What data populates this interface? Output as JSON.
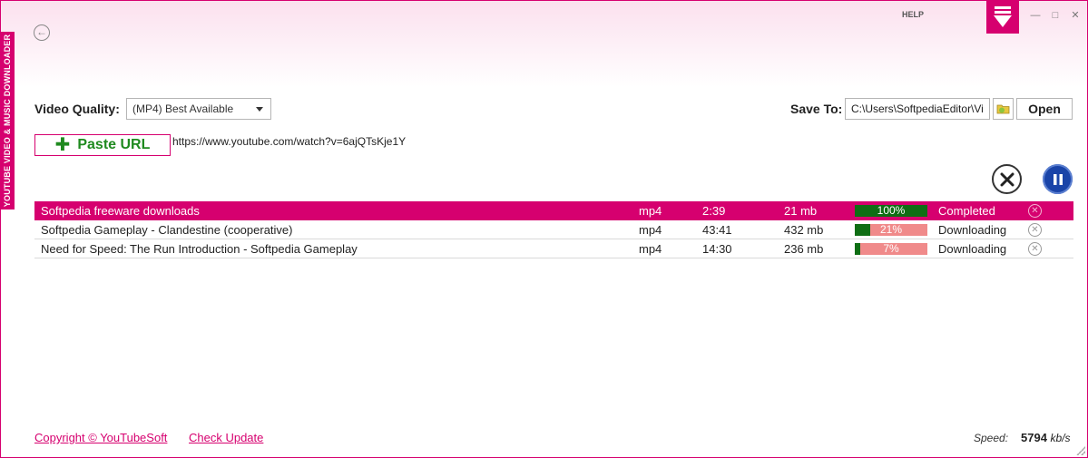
{
  "app": {
    "side_title": "YOUTUBE VIDEO & MUSIC DOWNLOADER",
    "help_label": "HELP",
    "brand_color": "#d6006f"
  },
  "settings": {
    "video_quality_label": "Video Quality:",
    "video_quality_value": "(MP4) Best Available",
    "save_to_label": "Save To:",
    "save_to_path": "C:\\Users\\SoftpediaEditor\\Vi",
    "open_label": "Open"
  },
  "url_bar": {
    "paste_label": "Paste URL",
    "url": "https://www.youtube.com/watch?v=6ajQTsKje1Y"
  },
  "downloads": [
    {
      "title": "Softpedia freeware downloads",
      "format": "mp4",
      "duration": "2:39",
      "size": "21 mb",
      "progress": 100,
      "progress_label": "100%",
      "status": "Completed",
      "selected": true
    },
    {
      "title": "Softpedia Gameplay - Clandestine (cooperative)",
      "format": "mp4",
      "duration": "43:41",
      "size": "432 mb",
      "progress": 21,
      "progress_label": "21%",
      "status": "Downloading",
      "selected": false
    },
    {
      "title": "Need for Speed: The Run Introduction - Softpedia Gameplay",
      "format": "mp4",
      "duration": "14:30",
      "size": "236 mb",
      "progress": 7,
      "progress_label": "7%",
      "status": "Downloading",
      "selected": false
    }
  ],
  "footer": {
    "copyright": "Copyright © YouTubeSoft",
    "check_update": "Check Update",
    "speed_label": "Speed:",
    "speed_value": "5794",
    "speed_unit": "kb/s"
  },
  "icons": {
    "back": "back-arrow-icon",
    "logo": "download-arrow-icon",
    "folder": "folder-icon",
    "cancel_all": "close-icon",
    "pause_all": "pause-icon"
  }
}
